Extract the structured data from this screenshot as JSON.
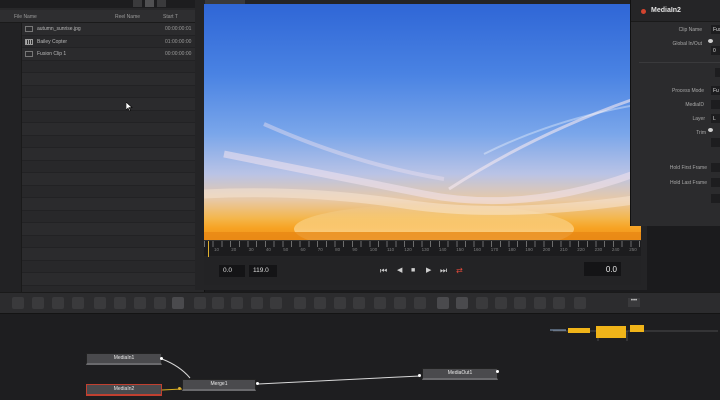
{
  "media_pool": {
    "columns": [
      "File Name",
      "Reel Name",
      "Start T"
    ],
    "items": [
      {
        "name": "autumn_sunrise.jpg",
        "timecode": "00:00:00:01",
        "thumb": "file"
      },
      {
        "name": "Bailey Copter",
        "timecode": "01:00:00:00",
        "thumb": "striped"
      },
      {
        "name": "Fusion Clip 1",
        "timecode": "00:00:00:00",
        "thumb": "file"
      }
    ]
  },
  "viewer": {
    "ruler_labels": [
      "10",
      "20",
      "30",
      "40",
      "50",
      "60",
      "70",
      "80",
      "90",
      "100",
      "110",
      "120",
      "130",
      "140",
      "150",
      "160",
      "170",
      "180",
      "190",
      "200",
      "210",
      "220",
      "230",
      "240",
      "250"
    ],
    "start_time": "0.0",
    "end_time": "119.0",
    "current_time": "0.0",
    "icons": {
      "first_frame": "⏮",
      "step_back": "◀",
      "stop": "■",
      "play": "▶",
      "last_frame": "⏭",
      "loop": "⇄"
    }
  },
  "inspector": {
    "node_name": "MediaIn2",
    "fields": [
      {
        "label": "Clip Name",
        "value": "Fusio"
      },
      {
        "label": "Global In/Out",
        "value": "0"
      },
      {
        "label": "Process Mode",
        "value": "Fu"
      },
      {
        "label": "MediaID",
        "value": ""
      },
      {
        "label": "Layer",
        "value": "L"
      },
      {
        "label": "Trim",
        "value": ""
      },
      {
        "label": "Hold First Frame",
        "value": ""
      },
      {
        "label": "Hold Last Frame",
        "value": ""
      }
    ]
  },
  "toolbar": {
    "more_label": "•••"
  },
  "node_editor": {
    "nodes": [
      {
        "id": "mediain1",
        "label": "MediaIn1"
      },
      {
        "id": "mediain2",
        "label": "MediaIn2"
      },
      {
        "id": "merge1",
        "label": "Merge1"
      },
      {
        "id": "mediaout1",
        "label": "MediaOut1"
      }
    ]
  },
  "colors": {
    "accent_yellow": "#f0b419",
    "loop_red": "#e04a3a",
    "selection_red": "#c04030"
  }
}
